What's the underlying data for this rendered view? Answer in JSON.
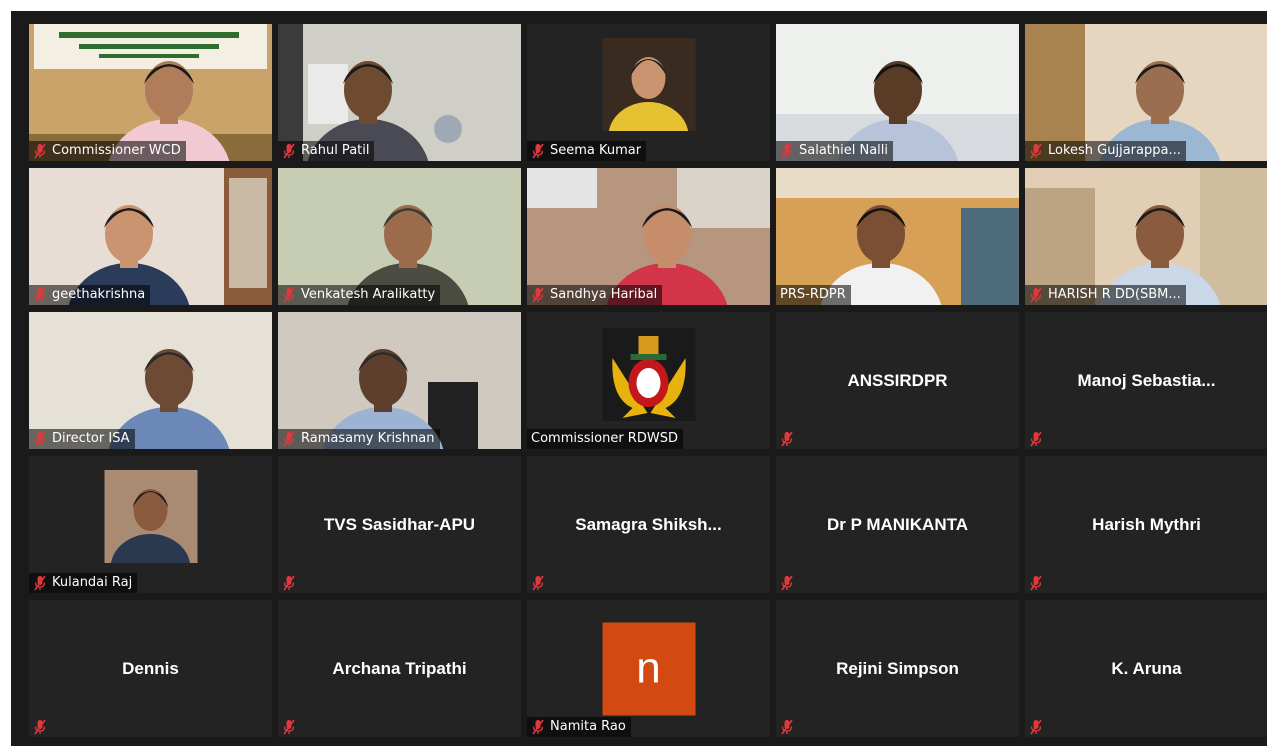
{
  "meeting": {
    "view": "gallery",
    "active_speaker": "PRS-RDPR",
    "colors": {
      "background": "#1a1a1a",
      "tile": "#232323",
      "active_border": "#d7e57a",
      "muted_icon": "#e0383b",
      "avatar_n": "#d24a12"
    }
  },
  "participants": [
    {
      "name": "Commissioner WCD",
      "muted": true,
      "video": true,
      "scene": "office-banner"
    },
    {
      "name": "Rahul Patil",
      "muted": true,
      "video": true,
      "scene": "room-fan"
    },
    {
      "name": "Seema Kumar",
      "muted": true,
      "video": false,
      "avatar": "photo"
    },
    {
      "name": "Salathiel Nalli",
      "muted": true,
      "video": true,
      "scene": "white-wall"
    },
    {
      "name": "Lokesh Gujjarappa...",
      "muted": true,
      "video": true,
      "scene": "beige-wall"
    },
    {
      "name": "geethakrishna",
      "muted": true,
      "video": true,
      "scene": "home-shelf"
    },
    {
      "name": "Venkatesh Aralikatty",
      "muted": true,
      "video": true,
      "scene": "green-wall"
    },
    {
      "name": "Sandhya Haribal",
      "muted": true,
      "video": true,
      "scene": "office-red"
    },
    {
      "name": "PRS-RDPR",
      "muted": false,
      "video": true,
      "scene": "office-wood",
      "active": true
    },
    {
      "name": "HARISH R DD(SBM...",
      "muted": true,
      "video": true,
      "scene": "cabinets"
    },
    {
      "name": "Director ISA",
      "muted": true,
      "video": true,
      "scene": "plain-wall"
    },
    {
      "name": "Ramasamy Krishnan",
      "muted": true,
      "video": true,
      "scene": "office-chair"
    },
    {
      "name": "Commissioner RDWSD",
      "muted": false,
      "video": false,
      "avatar": "emblem"
    },
    {
      "name": "ANSSIRDPR",
      "muted": true,
      "video": false
    },
    {
      "name": "Manoj  Sebastia...",
      "muted": true,
      "video": false
    },
    {
      "name": "Kulandai Raj",
      "muted": true,
      "video": false,
      "avatar": "photo"
    },
    {
      "name": "TVS Sasidhar-APU",
      "muted": true,
      "video": false
    },
    {
      "name": "Samagra  Shiksh...",
      "muted": true,
      "video": false
    },
    {
      "name": "Dr P MANIKANTA",
      "muted": true,
      "video": false
    },
    {
      "name": "Harish Mythri",
      "muted": true,
      "video": false
    },
    {
      "name": "Dennis",
      "muted": true,
      "video": false
    },
    {
      "name": "Archana Tripathi",
      "muted": true,
      "video": false
    },
    {
      "name": "Namita Rao",
      "muted": true,
      "video": false,
      "avatar": "letter",
      "avatar_letter": "n"
    },
    {
      "name": "Rejini Simpson",
      "muted": true,
      "video": false
    },
    {
      "name": "K.  Aruna",
      "muted": true,
      "video": false
    }
  ]
}
